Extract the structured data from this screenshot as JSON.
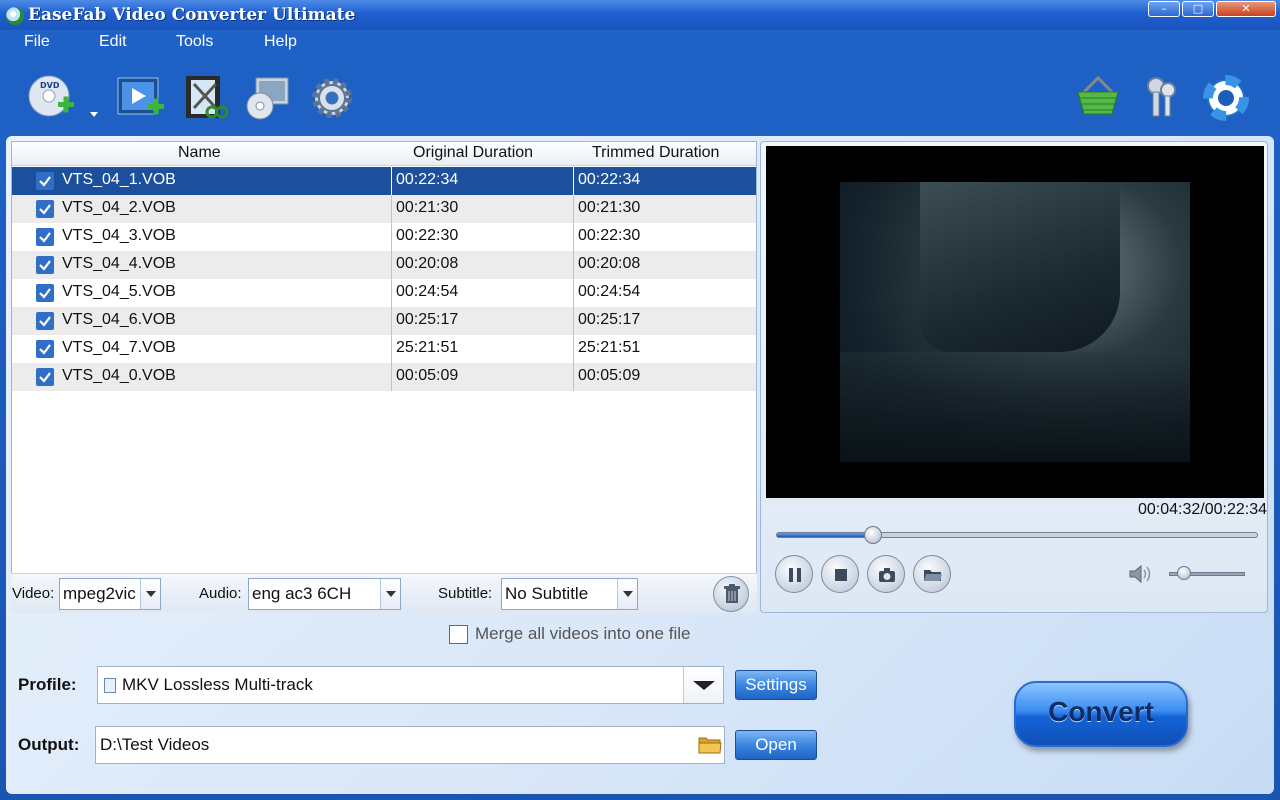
{
  "window": {
    "title": "EaseFab Video Converter Ultimate"
  },
  "menu": [
    "File",
    "Edit",
    "Tools",
    "Help"
  ],
  "columns": {
    "name": "Name",
    "original": "Original Duration",
    "trimmed": "Trimmed Duration"
  },
  "files": [
    {
      "name": "VTS_04_1.VOB",
      "original": "00:22:34",
      "trimmed": "00:22:34",
      "checked": true,
      "selected": true
    },
    {
      "name": "VTS_04_2.VOB",
      "original": "00:21:30",
      "trimmed": "00:21:30",
      "checked": true
    },
    {
      "name": "VTS_04_3.VOB",
      "original": "00:22:30",
      "trimmed": "00:22:30",
      "checked": true
    },
    {
      "name": "VTS_04_4.VOB",
      "original": "00:20:08",
      "trimmed": "00:20:08",
      "checked": true
    },
    {
      "name": "VTS_04_5.VOB",
      "original": "00:24:54",
      "trimmed": "00:24:54",
      "checked": true
    },
    {
      "name": "VTS_04_6.VOB",
      "original": "00:25:17",
      "trimmed": "00:25:17",
      "checked": true
    },
    {
      "name": "VTS_04_7.VOB",
      "original": "25:21:51",
      "trimmed": "25:21:51",
      "checked": true
    },
    {
      "name": "VTS_04_0.VOB",
      "original": "00:05:09",
      "trimmed": "00:05:09",
      "checked": true
    }
  ],
  "tracks": {
    "video_label": "Video:",
    "video_value": "mpeg2vic",
    "audio_label": "Audio:",
    "audio_value": "eng ac3 6CH",
    "subtitle_label": "Subtitle:",
    "subtitle_value": "No Subtitle"
  },
  "preview": {
    "timecode": "00:04:32/00:22:34",
    "progress": 0.2009,
    "volume": 0.2
  },
  "merge_label": "Merge all videos into one file",
  "profile": {
    "label": "Profile:",
    "value": "MKV Lossless Multi-track",
    "settings_button": "Settings"
  },
  "output": {
    "label": "Output:",
    "value": "D:\\Test Videos",
    "open_button": "Open"
  },
  "convert_button": "Convert",
  "toolbar_icons": [
    "load-dvd-icon",
    "add-video-icon",
    "edit-video-icon",
    "merge-disc-icon",
    "settings-gear-icon",
    "shop-basket-icon",
    "register-keys-icon",
    "help-lifebuoy-icon"
  ],
  "colors": {
    "accent": "#1f62c7",
    "selection": "#1c4f9c",
    "checkbox": "#2f6fc6"
  }
}
